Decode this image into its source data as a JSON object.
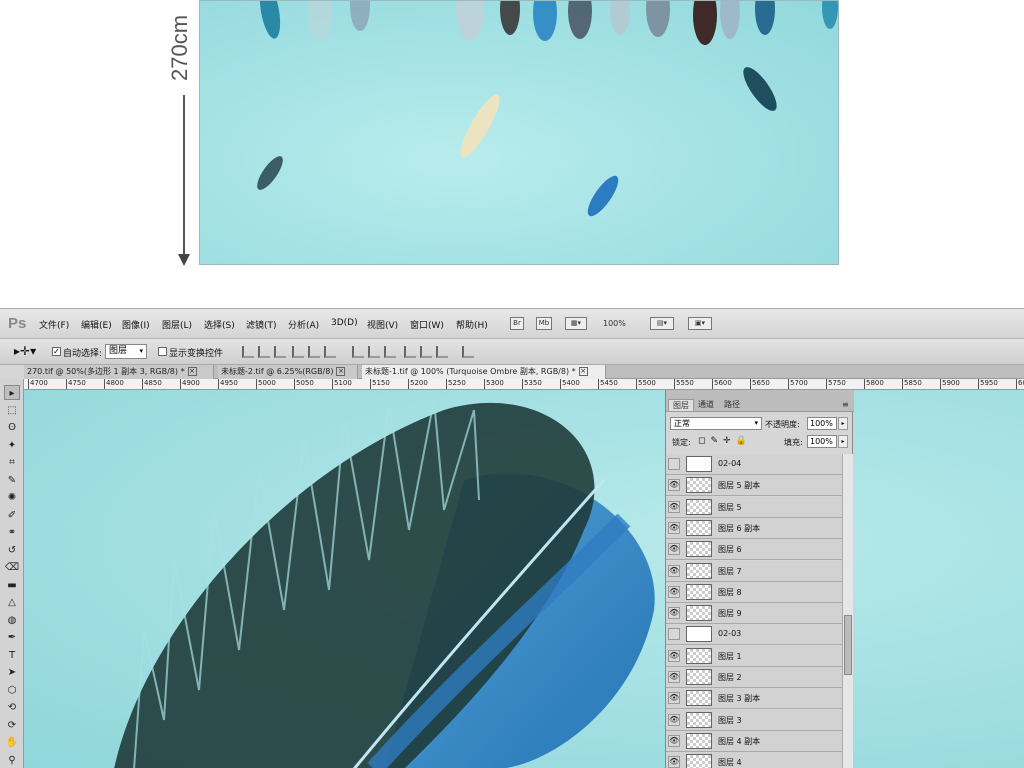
{
  "preview": {
    "dimension_label": "270cm"
  },
  "app": {
    "logo": "Ps",
    "menus": [
      "文件(F)",
      "编辑(E)",
      "图像(I)",
      "图层(L)",
      "选择(S)",
      "滤镜(T)",
      "分析(A)",
      "3D(D)",
      "视图(V)",
      "窗口(W)",
      "帮助(H)"
    ],
    "toolbar_icons": [
      "Br",
      "Mb"
    ],
    "zoom": "100%"
  },
  "options": {
    "auto_select_label": "自动选择:",
    "auto_select_checked": true,
    "auto_select_target": "图层",
    "show_transform_label": "显示变换控件",
    "show_transform_checked": false
  },
  "tabs": [
    {
      "label": "270.tif @ 50%(多边形 1 副本 3, RGB/8) *",
      "active": false
    },
    {
      "label": "未标题-2.tif @ 6.25%(RGB/8)",
      "active": false
    },
    {
      "label": "未标题-1.tif @ 100% (Turquoise Ombre 副本, RGB/8) *",
      "active": true
    }
  ],
  "ruler": [
    "4700",
    "4750",
    "4800",
    "4850",
    "4900",
    "4950",
    "5000",
    "5050",
    "5100",
    "5150",
    "5200",
    "5250",
    "5300",
    "5350",
    "5400",
    "5450",
    "5500",
    "5550",
    "5600",
    "5650",
    "5700",
    "5750",
    "5800",
    "5850",
    "5900",
    "5950",
    "60"
  ],
  "tools": [
    "move-tool",
    "marquee-tool",
    "lasso-tool",
    "quick-select-tool",
    "crop-tool",
    "eyedropper-tool",
    "healing-tool",
    "brush-tool",
    "clone-tool",
    "history-brush-tool",
    "eraser-tool",
    "gradient-tool",
    "blur-tool",
    "dodge-tool",
    "pen-tool",
    "type-tool",
    "path-select-tool",
    "shape-tool",
    "3d-rotate-tool",
    "3d-orbit-tool",
    "hand-tool",
    "zoom-tool"
  ],
  "layers_panel": {
    "tabs": [
      "图层",
      "通道",
      "路径"
    ],
    "blend_mode": "正常",
    "opacity_label": "不透明度:",
    "opacity": "100%",
    "lock_label": "锁定:",
    "fill_label": "填充:",
    "fill": "100%",
    "layers": [
      {
        "name": "02-04",
        "visible": false,
        "group": true
      },
      {
        "name": "图层 5 副本",
        "visible": true,
        "group": false
      },
      {
        "name": "图层 5",
        "visible": true,
        "group": false
      },
      {
        "name": "图层 6 副本",
        "visible": true,
        "group": false
      },
      {
        "name": "图层 6",
        "visible": true,
        "group": false
      },
      {
        "name": "图层 7",
        "visible": true,
        "group": false
      },
      {
        "name": "图层 8",
        "visible": true,
        "group": false
      },
      {
        "name": "图层 9",
        "visible": true,
        "group": false
      },
      {
        "name": "02-03",
        "visible": false,
        "group": true
      },
      {
        "name": "图层 1",
        "visible": true,
        "group": false
      },
      {
        "name": "图层 2",
        "visible": true,
        "group": false
      },
      {
        "name": "图层 3 副本",
        "visible": true,
        "group": false
      },
      {
        "name": "图层 3",
        "visible": true,
        "group": false
      },
      {
        "name": "图层 4 副本",
        "visible": true,
        "group": false
      },
      {
        "name": "图层 4",
        "visible": true,
        "group": false
      }
    ]
  }
}
